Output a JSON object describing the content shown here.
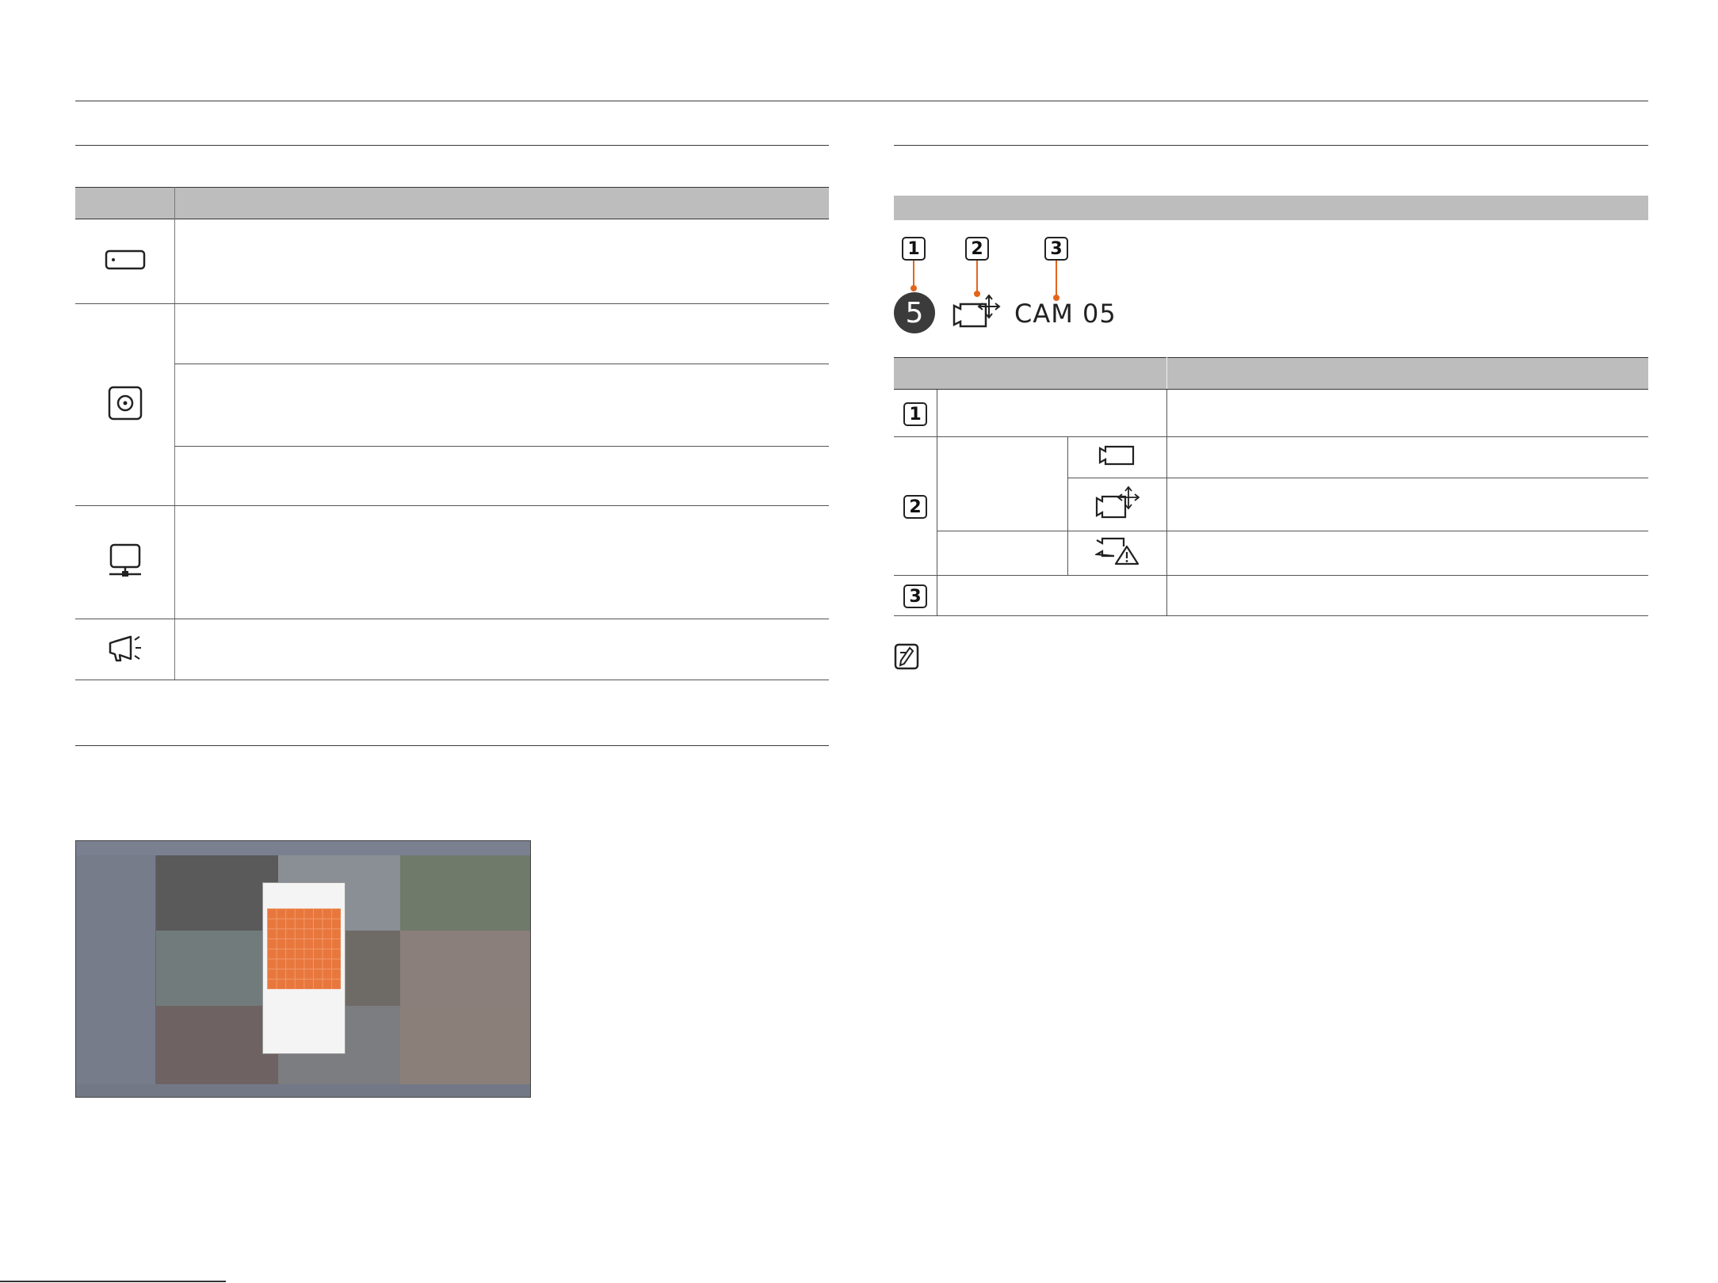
{
  "left_table": {
    "rows": [
      {
        "icon": "hdd-icon"
      },
      {
        "icon": "disc-icon"
      },
      {
        "icon": "network-icon"
      },
      {
        "icon": "alarm-speaker-icon"
      }
    ]
  },
  "camera_osd": {
    "callouts": [
      "1",
      "2",
      "3"
    ],
    "channel_number": "5",
    "camera_icon": "camera-ptz-icon",
    "camera_name": "CAM 05"
  },
  "right_table": {
    "rows": [
      {
        "badge": "1"
      },
      {
        "badge": "2",
        "icons": [
          "camera-icon",
          "camera-ptz-icon",
          "camera-warning-icon"
        ]
      },
      {
        "badge": "3"
      }
    ]
  },
  "note_icon": "note-icon",
  "screenshot": {
    "description_icon": "nvr-monitoring-screenshot"
  },
  "colors": {
    "accent": "#e3651d",
    "header_gray": "#bdbdbd",
    "badge_dark": "#3b3b3b"
  }
}
